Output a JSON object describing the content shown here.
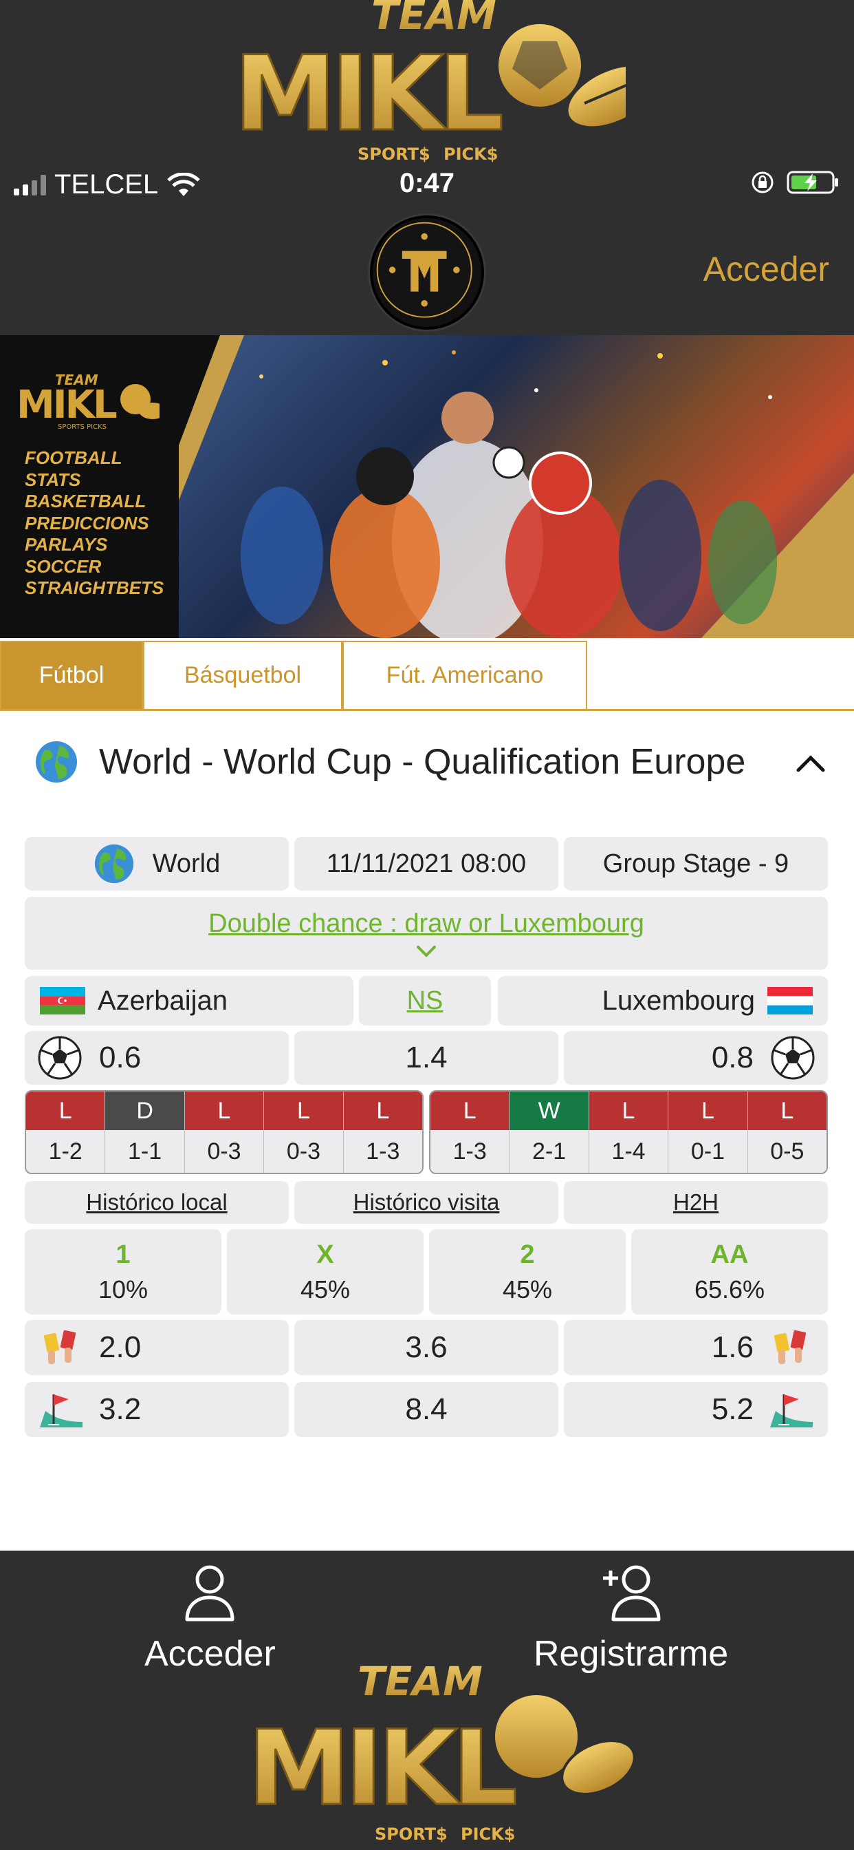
{
  "header": {
    "brand_logo_text": "TEAM MIKL SPORT$ PICK$",
    "acceder_label": "Acceder"
  },
  "status_bar": {
    "carrier": "TELCEL",
    "time": "0:47"
  },
  "banner": {
    "categories": [
      "FOOTBALL",
      "STATS",
      "BASKETBALL",
      "PREDICCIONS",
      "PARLAYS",
      "SOCCER",
      "STRAIGHTBETS"
    ]
  },
  "tabs": [
    {
      "label": "Fútbol",
      "active": true
    },
    {
      "label": "Básquetbol",
      "active": false
    },
    {
      "label": "Fút. Americano",
      "active": false
    }
  ],
  "league": {
    "title": "World - World Cup - Qualification Europe",
    "icon": "globe-icon"
  },
  "match": {
    "country": "World",
    "datetime": "11/11/2021 08:00",
    "round": "Group Stage - 9",
    "advice": "Double chance : draw or Luxembourg",
    "home_team": "Azerbaijan",
    "status": "NS",
    "away_team": "Luxembourg",
    "goals": {
      "home": "0.6",
      "total": "1.4",
      "away": "0.8"
    },
    "home_form": [
      {
        "result": "L",
        "score": "1-2"
      },
      {
        "result": "D",
        "score": "1-1"
      },
      {
        "result": "L",
        "score": "0-3"
      },
      {
        "result": "L",
        "score": "0-3"
      },
      {
        "result": "L",
        "score": "1-3"
      }
    ],
    "away_form": [
      {
        "result": "L",
        "score": "1-3"
      },
      {
        "result": "W",
        "score": "2-1"
      },
      {
        "result": "L",
        "score": "1-4"
      },
      {
        "result": "L",
        "score": "0-1"
      },
      {
        "result": "L",
        "score": "0-5"
      }
    ],
    "links": {
      "home_history": "Histórico local",
      "away_history": "Histórico visita",
      "h2h": "H2H"
    },
    "probabilities": [
      {
        "label": "1",
        "value": "10%"
      },
      {
        "label": "X",
        "value": "45%"
      },
      {
        "label": "2",
        "value": "45%"
      },
      {
        "label": "AA",
        "value": "65.6%"
      }
    ],
    "cards": {
      "home": "2.0",
      "total": "3.6",
      "away": "1.6"
    },
    "corners": {
      "home": "3.2",
      "total": "8.4",
      "away": "5.2"
    }
  },
  "colors": {
    "gold": "#d4a43a",
    "green": "#6fb52c",
    "loss": "#b83232",
    "draw": "#4a4a4a",
    "win": "#167a44",
    "dark": "#2f2f2f"
  },
  "bottom_nav": {
    "login_label": "Acceder",
    "register_label": "Registrarme"
  }
}
